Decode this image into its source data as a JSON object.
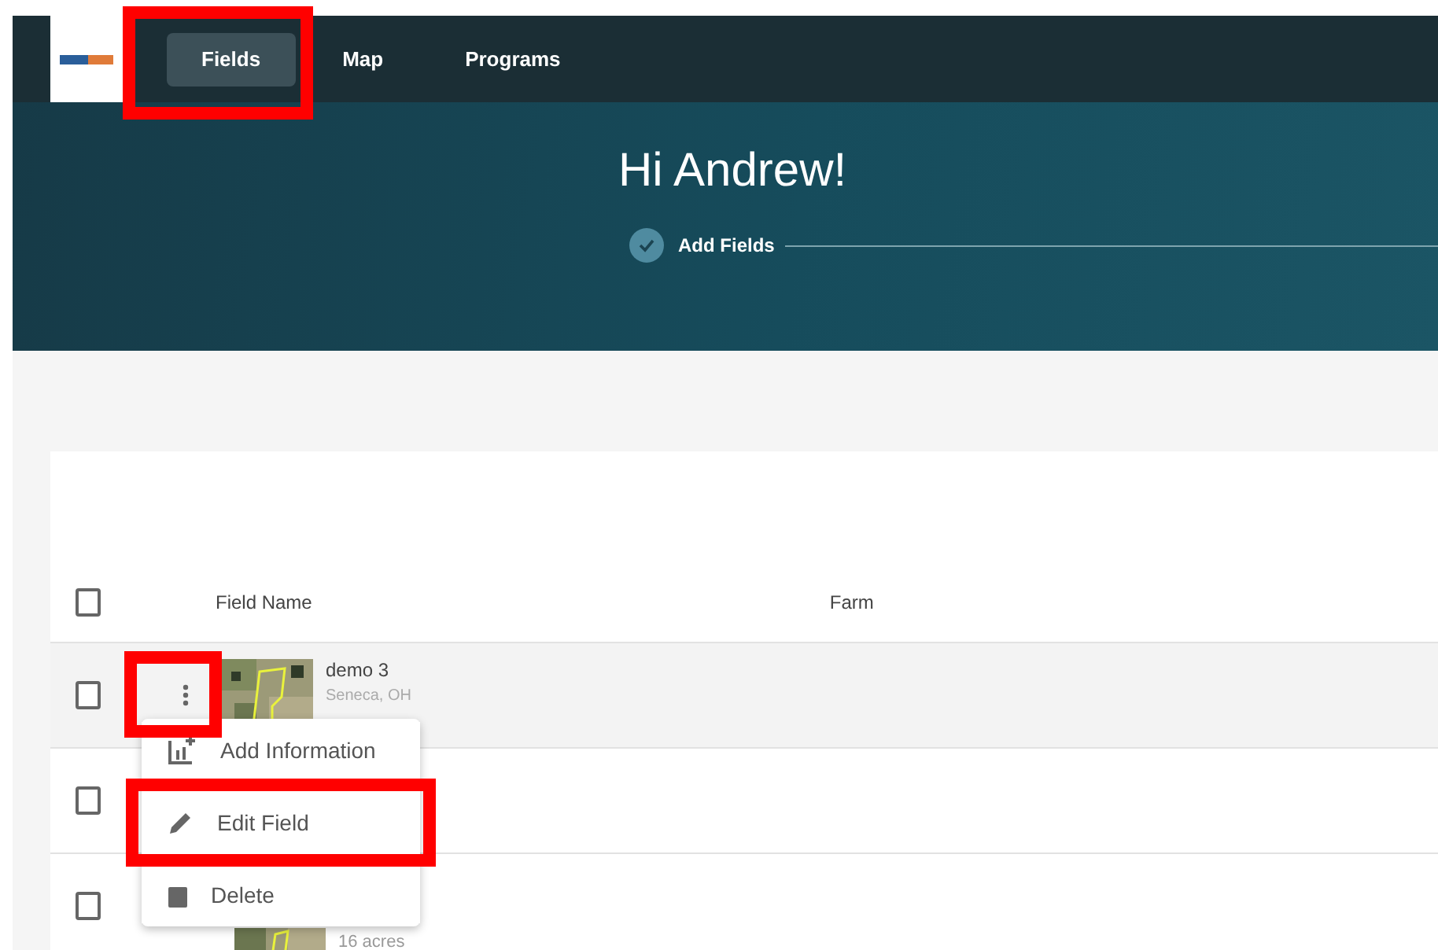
{
  "nav": {
    "items": [
      {
        "label": "Fields",
        "selected": true,
        "highlighted": true
      },
      {
        "label": "Map",
        "selected": false,
        "highlighted": false
      },
      {
        "label": "Programs",
        "selected": false,
        "highlighted": false
      }
    ]
  },
  "hero": {
    "greeting": "Hi Andrew!",
    "steps": [
      {
        "label": "Add Fields",
        "done": true
      }
    ]
  },
  "table": {
    "columns": [
      "Field Name",
      "Farm"
    ],
    "header_checked": false,
    "rows": [
      {
        "name": "demo 3",
        "location": "Seneca, OH",
        "checked": false,
        "hovered": true,
        "menu_highlighted": true
      },
      {
        "checked": false
      },
      {
        "acres": "16 acres",
        "checked": false
      }
    ]
  },
  "row_menu": {
    "items": [
      {
        "kind": "add-info",
        "label": "Add Information",
        "highlighted": false
      },
      {
        "kind": "edit",
        "label": "Edit Field",
        "highlighted": true
      },
      {
        "kind": "delete",
        "label": "Delete",
        "highlighted": false
      }
    ]
  }
}
